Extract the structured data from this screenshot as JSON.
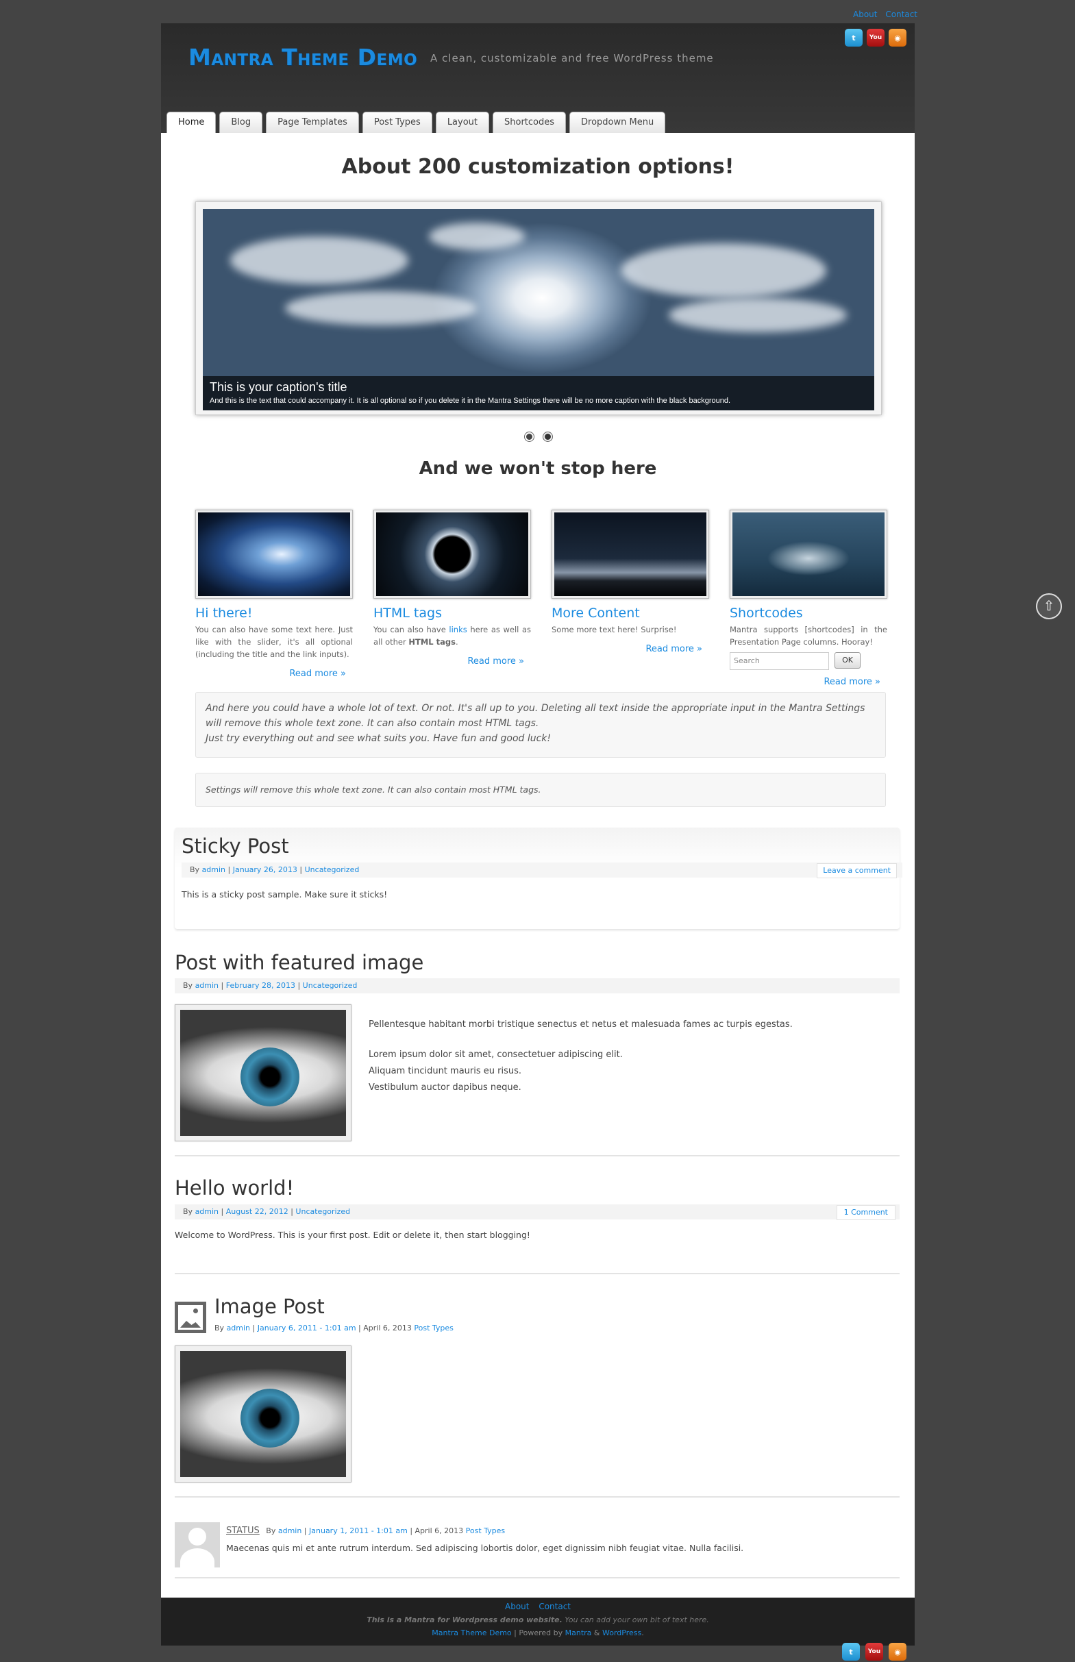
{
  "top_links": [
    "About",
    "Contact"
  ],
  "header": {
    "title": "Mantra Theme Demo",
    "description": "A clean, customizable and free WordPress theme",
    "social": [
      "twitter-icon",
      "youtube-icon",
      "rss-icon"
    ]
  },
  "menu": [
    "Home",
    "Blog",
    "Page Templates",
    "Post Types",
    "Layout",
    "Shortcodes",
    "Dropdown Menu"
  ],
  "presentation": {
    "heading": "About 200 customization options!",
    "slider": {
      "caption_title": "This is your caption's title",
      "caption_text": "And this is the text that could accompany it. It is all optional so if you delete it in the Mantra Settings there will be no more caption with the black background."
    },
    "subheading": "And we won't stop here",
    "columns": [
      {
        "title": "Hi there!",
        "text": "You can also have some text here. Just like with the slider, it's all optional (including the title and the link inputs).",
        "more": "Read more »"
      },
      {
        "title": "HTML tags",
        "text_pre": "You can also have ",
        "text_link": "links",
        "text_mid": " here as well as all other ",
        "text_bold": "HTML tags",
        "text_end": ".",
        "more": "Read more »"
      },
      {
        "title": "More Content",
        "text": "Some more text here! Surprise!",
        "more": "Read more »"
      },
      {
        "title": "Shortcodes",
        "text": "Mantra supports [shortcodes] in the Presentation Page columns. Hooray!",
        "search_placeholder": "Search",
        "search_button": "OK",
        "more": "Read more »"
      }
    ],
    "text_zone_1": [
      "And here you could have a whole lot of text. Or not. It's all up to you. Deleting all text inside the appropriate input in the Mantra Settings",
      "will remove this whole text zone. It can also contain most HTML tags.",
      "Just try everything out and see what suits you. Have fun and good luck!"
    ],
    "text_zone_2": "Settings will remove this whole text zone. It can also contain most HTML tags."
  },
  "posts": [
    {
      "title": "Sticky Post",
      "by": "By",
      "author": "admin",
      "date": "January 26, 2013",
      "category": "Uncategorized",
      "comments": "Leave a comment",
      "body": "This is a sticky post sample. Make sure it sticks!"
    },
    {
      "title": "Post with featured image",
      "by": "By",
      "author": "admin",
      "date": "February 28, 2013",
      "category": "Uncategorized",
      "body": [
        "Pellentesque habitant morbi tristique senectus et netus et malesuada fames ac turpis egestas.",
        "Lorem ipsum dolor sit amet, consectetuer adipiscing elit.",
        "Aliquam tincidunt mauris eu risus.",
        "Vestibulum auctor dapibus neque."
      ]
    },
    {
      "title": "Hello world!",
      "by": "By",
      "author": "admin",
      "date": "August 22, 2012",
      "category": "Uncategorized",
      "comments": "1 Comment",
      "body": "Welcome to WordPress. This is your first post. Edit or delete it, then start blogging!"
    },
    {
      "title": "Image Post",
      "by": "By",
      "author": "admin",
      "date": "January 6, 2011 - 1:01 am",
      "updated": "April 6, 2013",
      "category": "Post Types"
    },
    {
      "label": "STATUS",
      "by": "By",
      "author": "admin",
      "date": "January 1, 2011 - 1:01 am",
      "updated": "April 6, 2013",
      "category": "Post Types",
      "body": "Maecenas quis mi et ante rutrum interdum. Sed adipiscing lobortis dolor, eget dignissim nibh feugiat vitae. Nulla facilisi."
    }
  ],
  "footer": {
    "links": [
      "About",
      "Contact"
    ],
    "text_bold": "This is a Mantra for Wordpress demo website.",
    "text_rest": " You can add your own bit of text here.",
    "site": "Mantra Theme Demo",
    "powered_by": " | Powered by ",
    "theme": "Mantra",
    "amp": " & ",
    "wp": "WordPress",
    "period": "."
  },
  "colors": {
    "accent": "#1b8be0",
    "page_bg": "#444444",
    "header_bg": "#333333",
    "content_bg": "#ffffff"
  }
}
